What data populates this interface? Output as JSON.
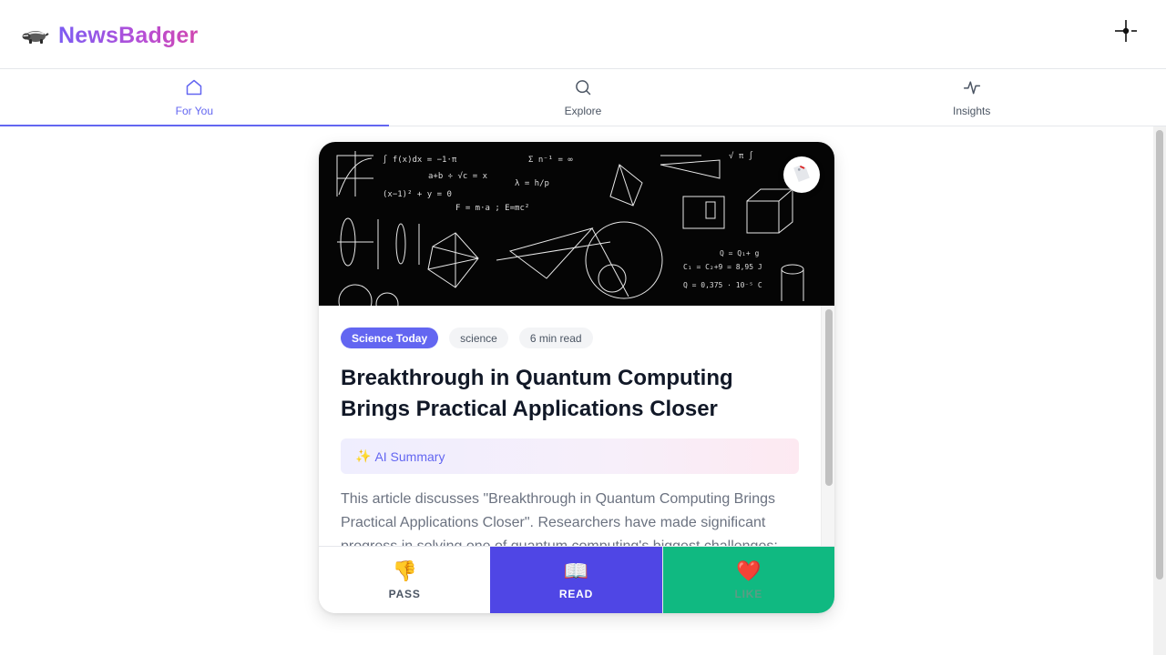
{
  "app": {
    "title": "NewsBadger",
    "logo_icon": "badger-icon",
    "settings_icon": "crosshair-settings-icon"
  },
  "tabs": [
    {
      "label": "For You",
      "icon": "home-icon",
      "active": true
    },
    {
      "label": "Explore",
      "icon": "search-icon",
      "active": false
    },
    {
      "label": "Insights",
      "icon": "activity-icon",
      "active": false
    }
  ],
  "card": {
    "source": "Science Today",
    "category": "science",
    "read_time": "6 min read",
    "headline": "Breakthrough in Quantum Computing Brings Practical Applications Closer",
    "ai_summary_label": "AI Summary",
    "ai_summary_icon": "sparkles-icon",
    "summary": "This article discusses \"Breakthrough in Quantum Computing Brings Practical Applications Closer\". Researchers have made significant progress in solving one of quantum computing's biggest challenges:",
    "bookmark_icon": "bookmark-icon"
  },
  "actions": [
    {
      "label": "PASS",
      "icon": "thumbs-down-icon",
      "emoji": "👎"
    },
    {
      "label": "READ",
      "icon": "open-book-icon",
      "emoji": "📖"
    },
    {
      "label": "LIKE",
      "icon": "heart-icon",
      "emoji": "❤️"
    }
  ],
  "colors": {
    "accent": "#6366f1",
    "read": "#4f46e5",
    "like": "#10b981"
  }
}
